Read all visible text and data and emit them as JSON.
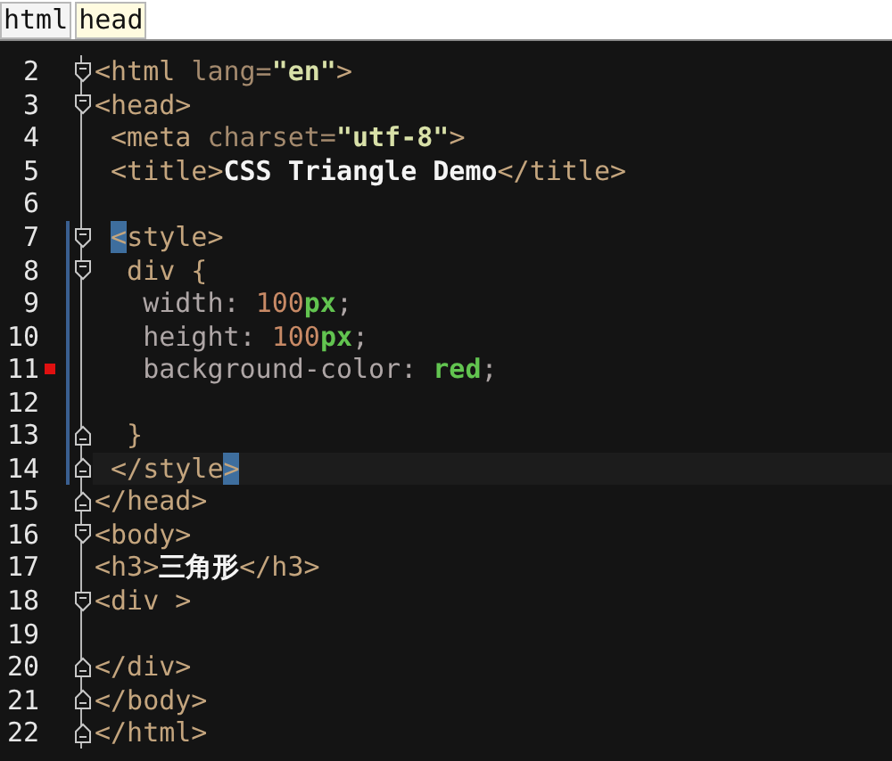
{
  "breadcrumb": [
    {
      "label": "html",
      "selected": false
    },
    {
      "label": "head",
      "selected": true
    }
  ],
  "lines": [
    {
      "number": "2",
      "fold_start": true,
      "fold_end": false,
      "scope": false,
      "bookmark": false,
      "current": false,
      "tokens": [
        {
          "kind": "tag",
          "text": "<html "
        },
        {
          "kind": "attr",
          "text": "lang="
        },
        {
          "kind": "string",
          "text": "\"en\""
        },
        {
          "kind": "tag",
          "text": ">"
        }
      ]
    },
    {
      "number": "3",
      "fold_start": true,
      "fold_end": false,
      "scope": false,
      "bookmark": false,
      "current": false,
      "tokens": [
        {
          "kind": "tag",
          "text": "<head>"
        }
      ]
    },
    {
      "number": "4",
      "fold_start": false,
      "fold_end": false,
      "scope": false,
      "bookmark": false,
      "current": false,
      "tokens": [
        {
          "kind": "tag",
          "text": " <meta "
        },
        {
          "kind": "attr",
          "text": "charset="
        },
        {
          "kind": "string",
          "text": "\"utf-8\""
        },
        {
          "kind": "tag",
          "text": ">"
        }
      ]
    },
    {
      "number": "5",
      "fold_start": false,
      "fold_end": false,
      "scope": false,
      "bookmark": false,
      "current": false,
      "tokens": [
        {
          "kind": "tag",
          "text": " <title>"
        },
        {
          "kind": "content",
          "text": "CSS Triangle Demo"
        },
        {
          "kind": "tag",
          "text": "</title>"
        }
      ]
    },
    {
      "number": "6",
      "fold_start": false,
      "fold_end": false,
      "scope": false,
      "bookmark": false,
      "current": false
    },
    {
      "number": "7",
      "fold_start": true,
      "fold_end": false,
      "scope": true,
      "bookmark": false,
      "current": false,
      "tokens": [
        {
          "kind": "match",
          "text": " <"
        },
        {
          "kind": "tag",
          "text": "style>"
        }
      ]
    },
    {
      "number": "8",
      "fold_start": true,
      "fold_end": false,
      "scope": true,
      "bookmark": false,
      "current": false,
      "tokens": [
        {
          "kind": "tag",
          "text": "  div {"
        }
      ]
    },
    {
      "number": "9",
      "fold_start": false,
      "fold_end": false,
      "scope": true,
      "bookmark": false,
      "current": false,
      "tokens": [
        {
          "kind": "prop",
          "text": "   width: "
        },
        {
          "kind": "number",
          "text": "100"
        },
        {
          "kind": "unit",
          "text": "px"
        },
        {
          "kind": "prop",
          "text": ";"
        }
      ]
    },
    {
      "number": "10",
      "fold_start": false,
      "fold_end": false,
      "scope": true,
      "bookmark": false,
      "current": false,
      "tokens": [
        {
          "kind": "prop",
          "text": "   height: "
        },
        {
          "kind": "number",
          "text": "100"
        },
        {
          "kind": "unit",
          "text": "px"
        },
        {
          "kind": "prop",
          "text": ";"
        }
      ]
    },
    {
      "number": "11",
      "fold_start": false,
      "fold_end": false,
      "scope": true,
      "bookmark": true,
      "current": false,
      "tokens": [
        {
          "kind": "prop",
          "text": "   background-color: "
        },
        {
          "kind": "unit",
          "text": "red"
        },
        {
          "kind": "prop",
          "text": ";"
        }
      ]
    },
    {
      "number": "12",
      "fold_start": false,
      "fold_end": false,
      "scope": true,
      "bookmark": false,
      "current": false
    },
    {
      "number": "13",
      "fold_start": false,
      "fold_end": true,
      "scope": true,
      "bookmark": false,
      "current": false,
      "tokens": [
        {
          "kind": "tag",
          "text": "  }"
        }
      ]
    },
    {
      "number": "14",
      "fold_start": false,
      "fold_end": true,
      "scope": true,
      "bookmark": false,
      "current": true,
      "tokens": [
        {
          "kind": "tag",
          "text": " </style"
        },
        {
          "kind": "match",
          "text": ">"
        }
      ]
    },
    {
      "number": "15",
      "fold_start": false,
      "fold_end": true,
      "scope": false,
      "bookmark": false,
      "current": false,
      "tokens": [
        {
          "kind": "tag",
          "text": "</head>"
        }
      ]
    },
    {
      "number": "16",
      "fold_start": true,
      "fold_end": false,
      "scope": false,
      "bookmark": false,
      "current": false,
      "tokens": [
        {
          "kind": "tag",
          "text": "<body>"
        }
      ]
    },
    {
      "number": "17",
      "fold_start": false,
      "fold_end": false,
      "scope": false,
      "bookmark": false,
      "current": false,
      "tokens": [
        {
          "kind": "tag",
          "text": "<h3>"
        },
        {
          "kind": "content",
          "text": "三角形"
        },
        {
          "kind": "tag",
          "text": "</h3>"
        }
      ]
    },
    {
      "number": "18",
      "fold_start": true,
      "fold_end": false,
      "scope": false,
      "bookmark": false,
      "current": false,
      "tokens": [
        {
          "kind": "tag",
          "text": "<div >"
        }
      ]
    },
    {
      "number": "19",
      "fold_start": false,
      "fold_end": false,
      "scope": false,
      "bookmark": false,
      "current": false
    },
    {
      "number": "20",
      "fold_start": false,
      "fold_end": true,
      "scope": false,
      "bookmark": false,
      "current": false,
      "tokens": [
        {
          "kind": "tag",
          "text": "</div>"
        }
      ]
    },
    {
      "number": "21",
      "fold_start": false,
      "fold_end": true,
      "scope": false,
      "bookmark": false,
      "current": false,
      "tokens": [
        {
          "kind": "tag",
          "text": "</body>"
        }
      ]
    },
    {
      "number": "22",
      "fold_start": false,
      "fold_end": true,
      "scope": false,
      "bookmark": false,
      "current": false,
      "tokens": [
        {
          "kind": "tag",
          "text": "</html>"
        }
      ]
    }
  ]
}
